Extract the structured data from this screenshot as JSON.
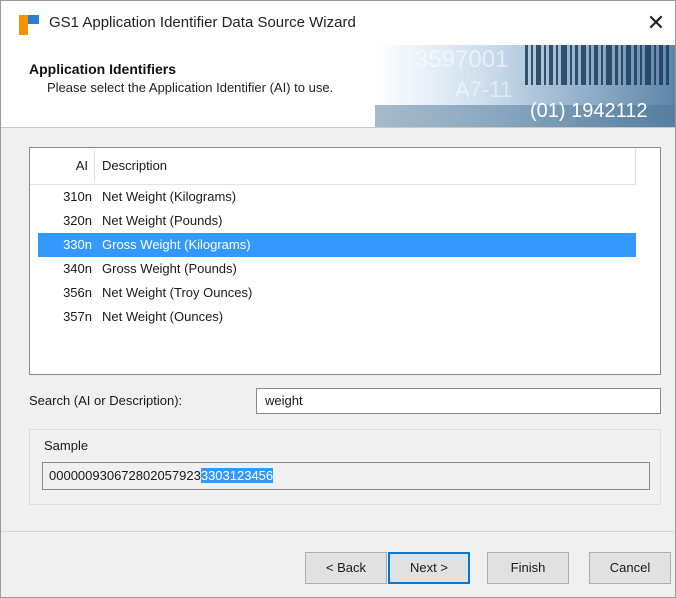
{
  "window": {
    "title": "GS1 Application Identifier Data Source Wizard",
    "close": "✕"
  },
  "header": {
    "title": "Application Identifiers",
    "subtitle": "Please select the Application Identifier (AI) to use.",
    "banner_text_1": "3597001",
    "banner_text_2": "A7-11",
    "banner_text_3": "(01) 1942112"
  },
  "list": {
    "columns": {
      "ai": "AI",
      "description": "Description"
    },
    "rows": [
      {
        "ai": "310n",
        "description": "Net Weight (Kilograms)",
        "selected": false
      },
      {
        "ai": "320n",
        "description": "Net Weight (Pounds)",
        "selected": false
      },
      {
        "ai": "330n",
        "description": "Gross Weight (Kilograms)",
        "selected": true
      },
      {
        "ai": "340n",
        "description": "Gross Weight (Pounds)",
        "selected": false
      },
      {
        "ai": "356n",
        "description": "Net Weight (Troy Ounces)",
        "selected": false
      },
      {
        "ai": "357n",
        "description": "Net Weight (Ounces)",
        "selected": false
      }
    ]
  },
  "search": {
    "label": "Search (AI or Description):",
    "value": "weight"
  },
  "sample": {
    "legend": "Sample",
    "prefix": "000000930672802057923",
    "highlighted": "3303123456"
  },
  "buttons": {
    "back": "< Back",
    "next": "Next >",
    "finish": "Finish",
    "cancel": "Cancel"
  },
  "colors": {
    "selection": "#3399ff",
    "dialog_bg": "#f0f0f0",
    "default_button_border": "#0078d7"
  }
}
